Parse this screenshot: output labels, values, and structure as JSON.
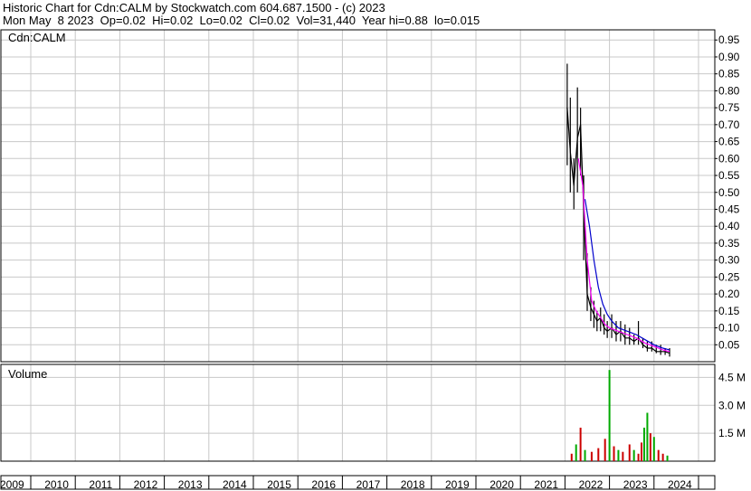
{
  "header": {
    "line1": "Historic Chart for Cdn:CALM by Stockwatch.com 604.687.1500 - (c) 2023",
    "line2": "Mon May  8 2023  Op=0.02  Hi=0.02  Lo=0.02  Cl=0.02  Vol=31,440  Year hi=0.88  lo=0.015"
  },
  "chart_data": {
    "type": "line",
    "price_panel": {
      "label": "Cdn:CALM",
      "ylim": [
        0.0,
        0.98
      ],
      "yticks": [
        "0.95",
        "0.90",
        "0.85",
        "0.80",
        "0.75",
        "0.70",
        "0.65",
        "0.60",
        "0.55",
        "0.50",
        "0.45",
        "0.40",
        "0.35",
        "0.30",
        "0.25",
        "0.20",
        "0.15",
        "0.10",
        "0.05"
      ],
      "series": [
        {
          "color": "#000000",
          "style": "price-bars",
          "x": [
            2021.05,
            2021.12,
            2021.2,
            2021.28,
            2021.35,
            2021.42,
            2021.5,
            2021.58,
            2021.65,
            2021.72,
            2021.8,
            2021.88,
            2021.95,
            2022.05,
            2022.15,
            2022.25,
            2022.35,
            2022.45,
            2022.55,
            2022.65,
            2022.75,
            2022.85,
            2022.95,
            2023.05,
            2023.15,
            2023.25,
            2023.35
          ],
          "values": [
            0.75,
            0.62,
            0.52,
            0.66,
            0.7,
            0.45,
            0.2,
            0.16,
            0.14,
            0.12,
            0.13,
            0.1,
            0.09,
            0.1,
            0.08,
            0.09,
            0.07,
            0.07,
            0.06,
            0.07,
            0.05,
            0.04,
            0.04,
            0.03,
            0.03,
            0.03,
            0.025
          ],
          "highs": [
            0.88,
            0.78,
            0.6,
            0.81,
            0.75,
            0.55,
            0.32,
            0.22,
            0.18,
            0.15,
            0.16,
            0.14,
            0.12,
            0.14,
            0.12,
            0.12,
            0.11,
            0.1,
            0.08,
            0.12,
            0.07,
            0.06,
            0.06,
            0.05,
            0.05,
            0.04,
            0.04
          ],
          "lows": [
            0.58,
            0.5,
            0.45,
            0.5,
            0.55,
            0.3,
            0.15,
            0.12,
            0.1,
            0.09,
            0.09,
            0.08,
            0.07,
            0.07,
            0.06,
            0.06,
            0.05,
            0.05,
            0.05,
            0.05,
            0.04,
            0.03,
            0.03,
            0.025,
            0.02,
            0.02,
            0.015
          ]
        },
        {
          "color": "#ff00ff",
          "style": "moving-average",
          "x": [
            2021.3,
            2021.4,
            2021.5,
            2021.6,
            2021.7,
            2021.8,
            2021.9,
            2022.0,
            2022.2,
            2022.4,
            2022.6,
            2022.8,
            2023.0,
            2023.2,
            2023.35
          ],
          "values": [
            0.6,
            0.52,
            0.3,
            0.18,
            0.15,
            0.13,
            0.11,
            0.1,
            0.09,
            0.08,
            0.07,
            0.055,
            0.045,
            0.035,
            0.03
          ]
        },
        {
          "color": "#0000cc",
          "style": "moving-average",
          "x": [
            2021.45,
            2021.55,
            2021.65,
            2021.75,
            2021.85,
            2021.95,
            2022.05,
            2022.2,
            2022.4,
            2022.6,
            2022.8,
            2023.0,
            2023.2,
            2023.35
          ],
          "values": [
            0.48,
            0.4,
            0.3,
            0.22,
            0.17,
            0.14,
            0.12,
            0.1,
            0.09,
            0.08,
            0.065,
            0.05,
            0.04,
            0.035
          ]
        }
      ]
    },
    "volume_panel": {
      "label": "Volume",
      "ylim": [
        0,
        5.2
      ],
      "yticks": [
        "4.5 M",
        "3.0 M",
        "1.5 M"
      ],
      "x": [
        2021.15,
        2021.25,
        2021.35,
        2021.45,
        2021.6,
        2021.75,
        2021.9,
        2022.0,
        2022.1,
        2022.2,
        2022.3,
        2022.45,
        2022.55,
        2022.65,
        2022.72,
        2022.78,
        2022.85,
        2022.92,
        2023.0,
        2023.1,
        2023.2,
        2023.3
      ],
      "values": [
        0.4,
        0.9,
        1.8,
        0.6,
        0.5,
        0.7,
        1.2,
        4.9,
        0.8,
        0.6,
        0.5,
        0.9,
        0.6,
        0.4,
        1.0,
        1.8,
        2.6,
        1.5,
        1.3,
        0.6,
        0.4,
        0.3
      ],
      "colors": [
        "#cc0000",
        "#00aa00",
        "#cc0000",
        "#00aa00",
        "#cc0000",
        "#cc0000",
        "#cc0000",
        "#00aa00",
        "#cc0000",
        "#00aa00",
        "#cc0000",
        "#cc0000",
        "#00aa00",
        "#cc0000",
        "#cc0000",
        "#00aa00",
        "#00aa00",
        "#cc0000",
        "#00aa00",
        "#cc0000",
        "#cc0000",
        "#00aa00"
      ]
    },
    "x_axis": {
      "xlim": [
        2009,
        2024
      ],
      "ticks": [
        "2009",
        "2010",
        "2011",
        "2012",
        "2013",
        "2014",
        "2015",
        "2016",
        "2017",
        "2018",
        "2019",
        "2020",
        "2021",
        "2022",
        "2023",
        "2024"
      ]
    },
    "grid": true
  }
}
